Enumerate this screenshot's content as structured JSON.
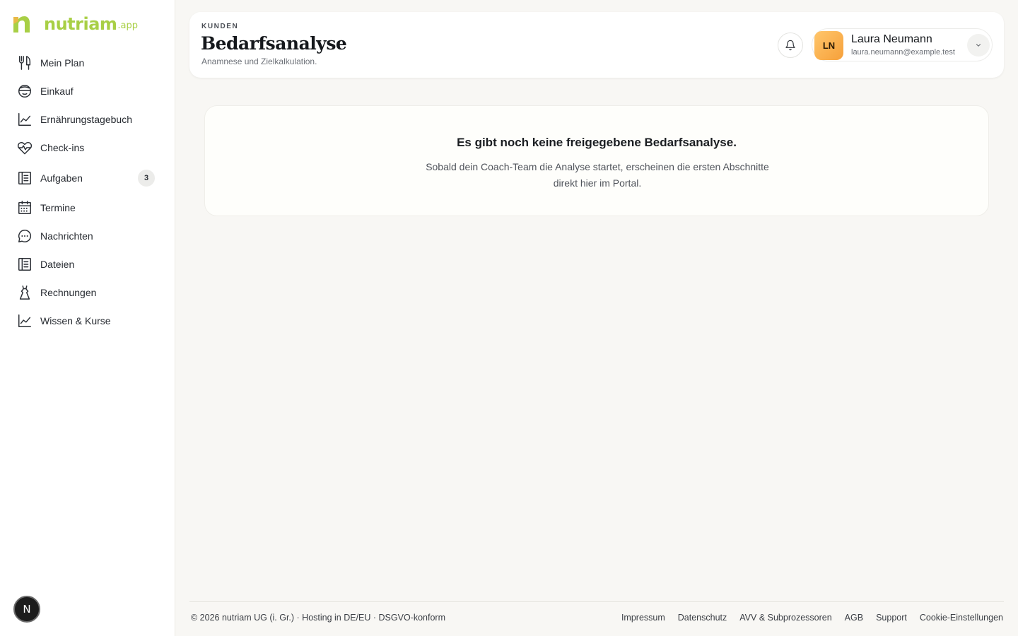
{
  "brand": {
    "name": "nutriam",
    "suffix": ".app",
    "color": "#a8cf45"
  },
  "sidebar": {
    "items": [
      {
        "label": "Mein Plan",
        "icon": "fork-knife-icon"
      },
      {
        "label": "Einkauf",
        "icon": "bowl-icon"
      },
      {
        "label": "Ernährungstagebuch",
        "icon": "trend-chart-icon"
      },
      {
        "label": "Check-ins",
        "icon": "heart-pulse-icon"
      },
      {
        "label": "Aufgaben",
        "icon": "list-icon",
        "badge": "3"
      },
      {
        "label": "Termine",
        "icon": "calendar-icon"
      },
      {
        "label": "Nachrichten",
        "icon": "chat-bubble-icon"
      },
      {
        "label": "Dateien",
        "icon": "file-list-icon"
      },
      {
        "label": "Rechnungen",
        "icon": "dress-icon"
      },
      {
        "label": "Wissen & Kurse",
        "icon": "trend-chart-icon"
      }
    ],
    "fab_letter": "N"
  },
  "header": {
    "eyebrow": "KUNDEN",
    "title": "Bedarfsanalyse",
    "subtitle": "Anamnese und Zielkalkulation."
  },
  "user": {
    "initials": "LN",
    "name": "Laura Neumann",
    "email": "laura.neumann@example.test"
  },
  "empty_state": {
    "title": "Es gibt noch keine freigegebene Bedarfsanalyse.",
    "text": "Sobald dein Coach-Team die Analyse startet, erscheinen die ersten Abschnitte direkt hier im Portal."
  },
  "footer": {
    "copyright": "© 2026 nutriam UG (i. Gr.) · Hosting in DE/EU · DSGVO-konform",
    "links": [
      "Impressum",
      "Datenschutz",
      "AVV & Subprozessoren",
      "AGB",
      "Support",
      "Cookie-Einstellungen"
    ]
  }
}
